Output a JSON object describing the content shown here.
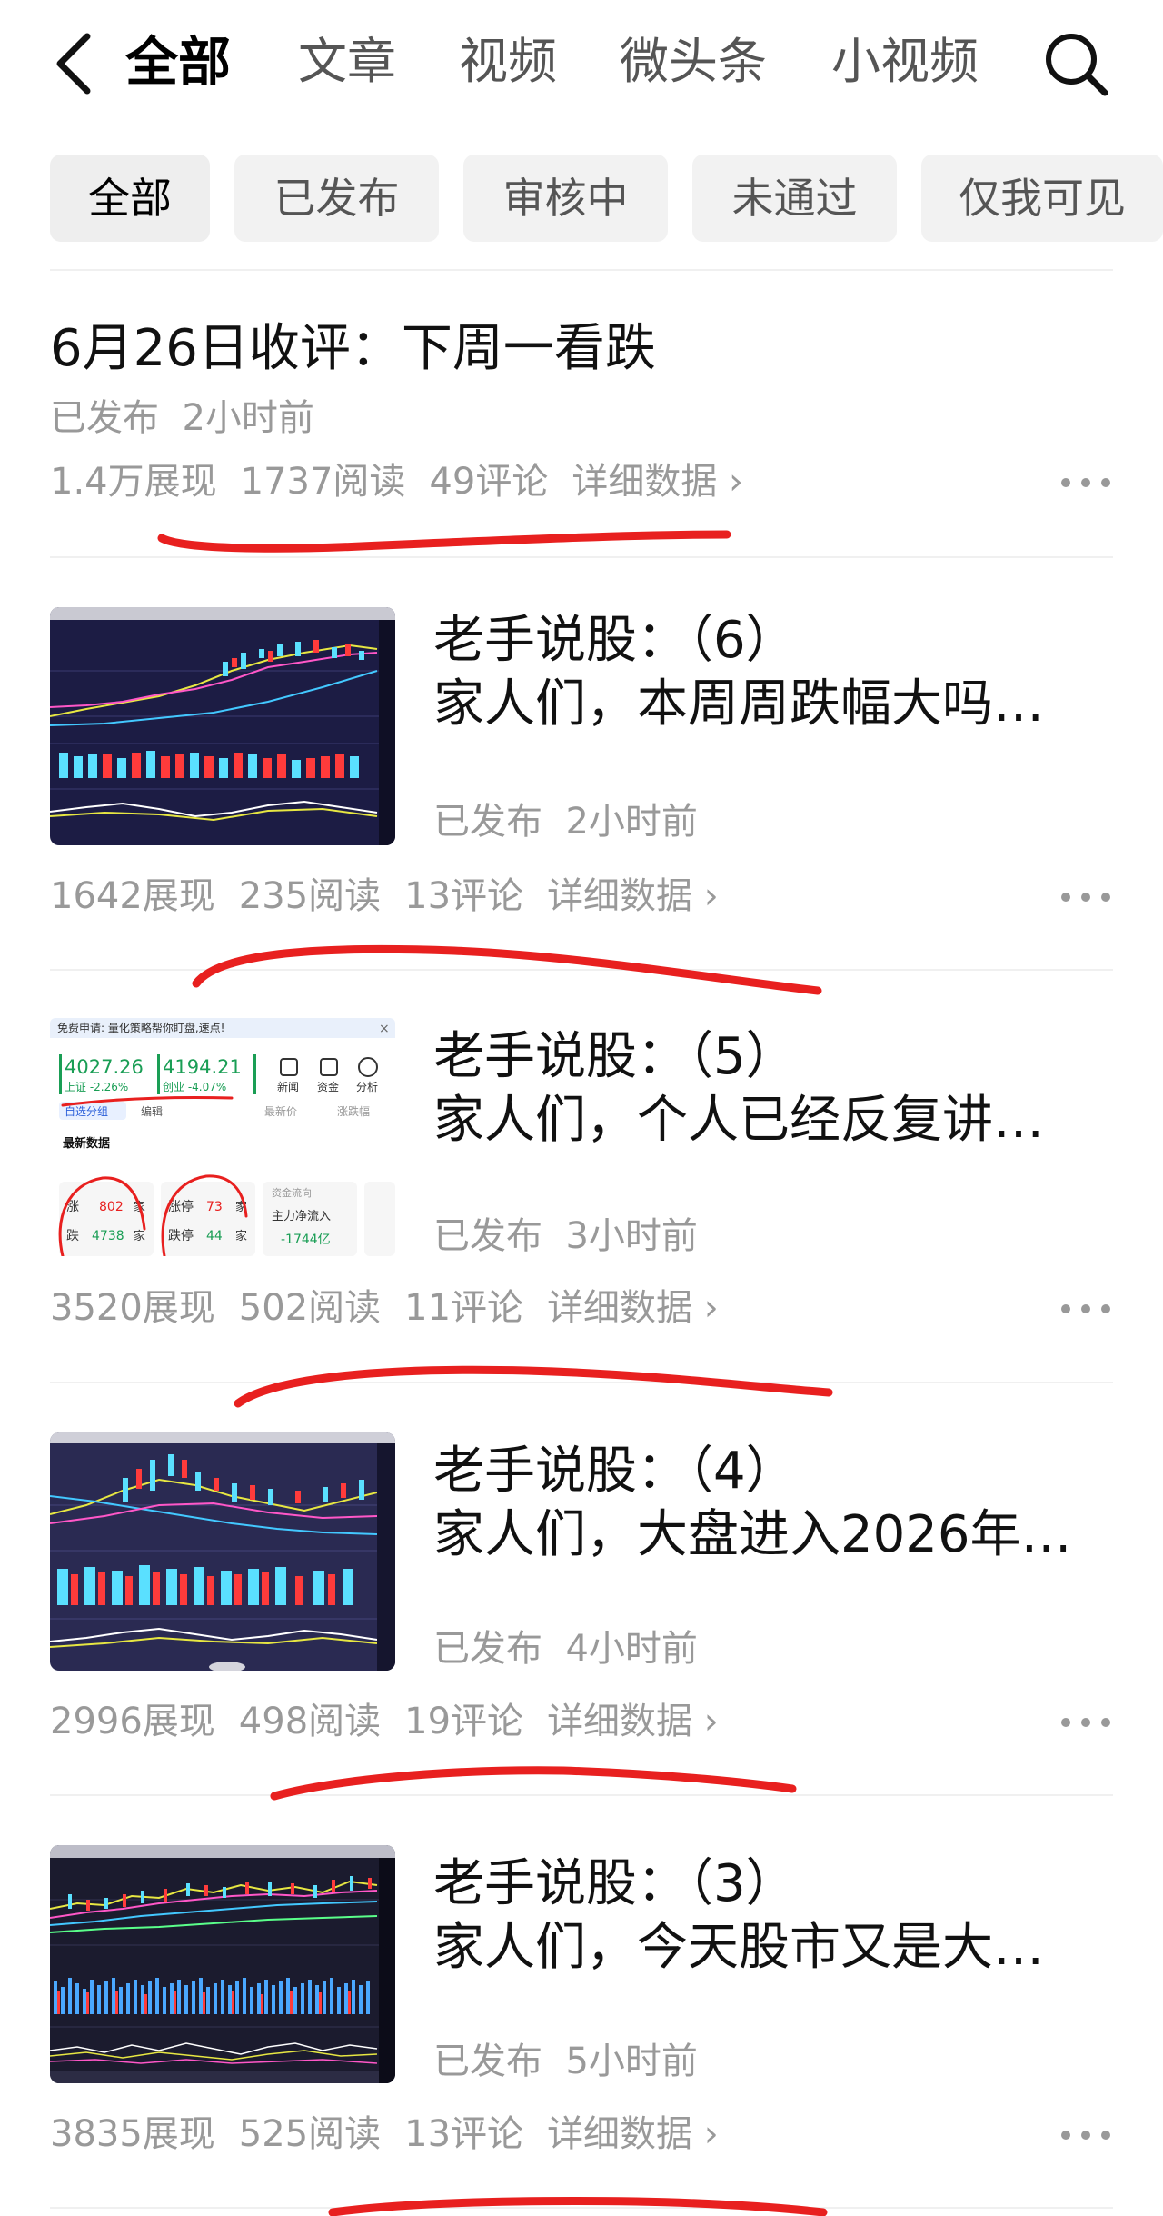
{
  "nav": {
    "tabs": [
      {
        "label": "全部",
        "active": true
      },
      {
        "label": "文章",
        "active": false
      },
      {
        "label": "视频",
        "active": false
      },
      {
        "label": "微头条",
        "active": false
      },
      {
        "label": "小视频",
        "active": false
      }
    ],
    "back_icon": "chevron-left-icon",
    "search_icon": "search-icon"
  },
  "filters": [
    "全部",
    "已发布",
    "审核中",
    "未通过",
    "仅我可见"
  ],
  "posts": [
    {
      "title": "6月26日收评：下周一看跌",
      "status": "已发布",
      "time": "2小时前",
      "impressions": "1.4万展现",
      "reads": "1737阅读",
      "comments": "49评论",
      "detail": "详细数据 ›"
    },
    {
      "title1": "老手说股：（6）",
      "title2": "家人们，本周周跌幅大吗…",
      "status": "已发布",
      "time": "2小时前",
      "impressions": "1642展现",
      "reads": "235阅读",
      "comments": "13评论",
      "detail": "详细数据 ›",
      "thumbnail": "stock-chart-thumbnail"
    },
    {
      "title1": "老手说股：（5）",
      "title2": "家人们，个人已经反复讲…",
      "status": "已发布",
      "time": "3小时前",
      "impressions": "3520展现",
      "reads": "502阅读",
      "comments": "11评论",
      "detail": "详细数据 ›",
      "thumbnail": "market-app-screenshot-thumbnail",
      "thumb_text": {
        "banner": "免费申请: 量化策略帮你盯盘,速点!",
        "idx1_val": "4027.26",
        "idx1_name": "上证 -2.26%",
        "idx2_val": "4194.21",
        "idx2_name": "创业 -4.07%",
        "btn_news": "新闻",
        "btn_funds": "资金",
        "btn_ai": "分析",
        "tab_group": "自选分组",
        "tab_edit": "编辑",
        "tab_price": "最新价",
        "tab_change": "涨跌幅",
        "section": "最新数据",
        "rise_label": "涨",
        "rise_val": "802",
        "fall_label": "跌",
        "fall_val": "4738",
        "limit_up_label": "涨停",
        "limit_up_val": "73",
        "limit_down_label": "跌停",
        "limit_down_val": "44",
        "unit": "家",
        "flow_title": "资金流向",
        "flow_label": "主力净流入",
        "flow_val": "-1744亿"
      }
    },
    {
      "title1": "老手说股：（4）",
      "title2": "家人们，大盘进入2026年…",
      "status": "已发布",
      "time": "4小时前",
      "impressions": "2996展现",
      "reads": "498阅读",
      "comments": "19评论",
      "detail": "详细数据 ›",
      "thumbnail": "stock-chart-thumbnail"
    },
    {
      "title1": "老手说股：（3）",
      "title2": "家人们，今天股市又是大…",
      "status": "已发布",
      "time": "5小时前",
      "impressions": "3835展现",
      "reads": "525阅读",
      "comments": "13评论",
      "detail": "详细数据 ›",
      "thumbnail": "stock-chart-thumbnail"
    }
  ],
  "colors": {
    "annotation_red": "#e8201f",
    "muted_text": "#999999",
    "chip_bg": "#f2f2f2",
    "stock_up": "#e8201f",
    "stock_down": "#1a9e55"
  }
}
